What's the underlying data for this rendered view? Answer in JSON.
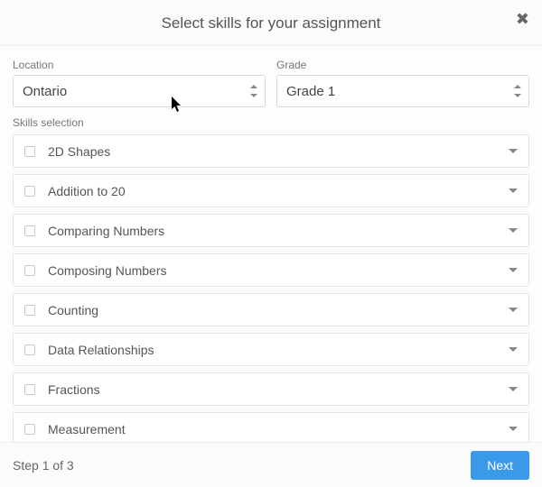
{
  "header": {
    "title": "Select skills for your assignment"
  },
  "filters": {
    "location_label": "Location",
    "location_value": "Ontario",
    "grade_label": "Grade",
    "grade_value": "Grade 1"
  },
  "skills": {
    "section_label": "Skills selection",
    "items": [
      {
        "label": "2D Shapes"
      },
      {
        "label": "Addition to 20"
      },
      {
        "label": "Comparing Numbers"
      },
      {
        "label": "Composing Numbers"
      },
      {
        "label": "Counting"
      },
      {
        "label": "Data Relationships"
      },
      {
        "label": "Fractions"
      },
      {
        "label": "Measurement"
      }
    ]
  },
  "footer": {
    "step_text": "Step 1 of 3",
    "next_label": "Next"
  }
}
